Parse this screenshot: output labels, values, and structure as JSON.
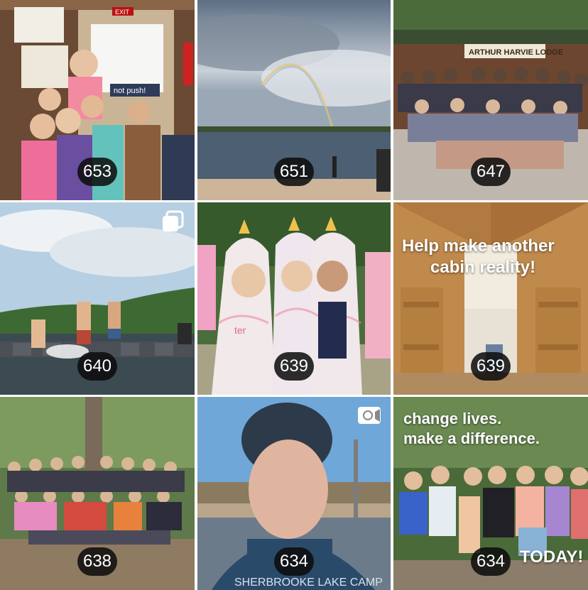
{
  "grid": {
    "posts": [
      {
        "count": "653",
        "scene": "kids-at-doorway"
      },
      {
        "count": "651",
        "scene": "lake-rainbow"
      },
      {
        "count": "647",
        "scene": "group-at-lodge"
      },
      {
        "count": "640",
        "scene": "swimmers-on-dock",
        "icon": "multiple-photos-icon"
      },
      {
        "count": "639",
        "scene": "girls-in-unicorn-towels"
      },
      {
        "count": "639",
        "scene": "cabin-interior"
      },
      {
        "count": "638",
        "scene": "group-in-forest"
      },
      {
        "count": "634",
        "scene": "young-man-selfie",
        "icon": "video-icon"
      },
      {
        "count": "634",
        "scene": "girls-group-outdoors"
      }
    ]
  },
  "overlays": {
    "lodge_sign": "ARTHUR HARVIE LODGE",
    "exit_sign": "EXIT",
    "door_sign": "not push!",
    "cabin_line1": "Help make another",
    "cabin_line2": "cabin reality!",
    "change_line1": "change lives.",
    "change_line2": "make a difference.",
    "today": "TODAY!",
    "shirt_text": "SHERBROOKE LAKE CAMP",
    "towel_text": "ter"
  },
  "colors": {
    "badge_bg": "#0c0c0c",
    "sky_blue": "#6fa7d8",
    "forest_green": "#3f6b3a",
    "wood": "#c98d4a"
  }
}
